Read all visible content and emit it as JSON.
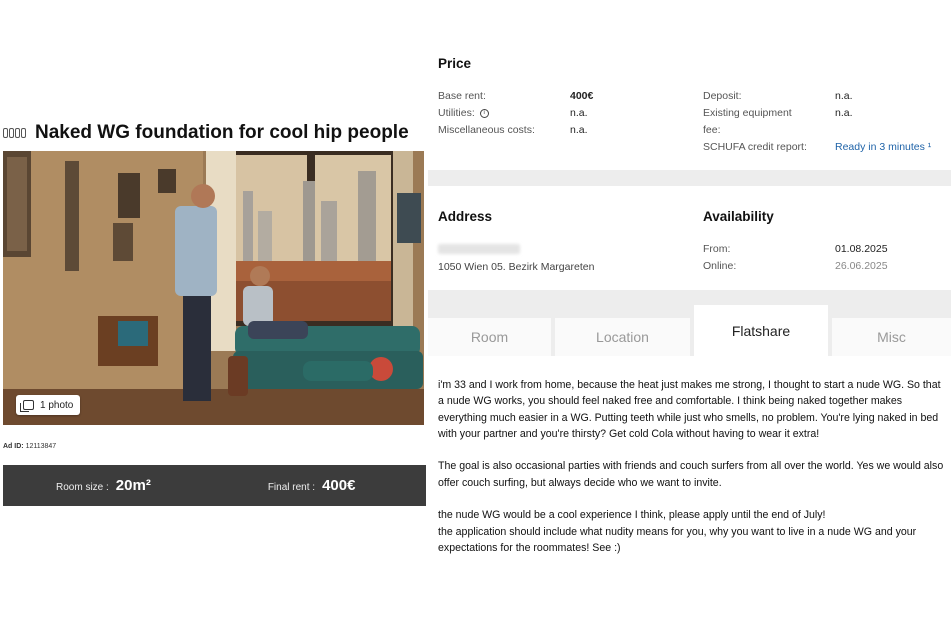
{
  "listing": {
    "title": "Naked WG foundation for cool hip people",
    "photo_label": "1 photo",
    "ad_id_label": "Ad ID:",
    "ad_id": "12113847",
    "room_size_label": "Room size :",
    "room_size": "20m²",
    "final_rent_label": "Final rent :",
    "final_rent": "400€"
  },
  "price": {
    "title": "Price",
    "base_rent_label": "Base rent:",
    "base_rent": "400€",
    "utilities_label": "Utilities:",
    "utilities": "n.a.",
    "misc_label": "Miscellaneous costs:",
    "misc": "n.a.",
    "deposit_label": "Deposit:",
    "deposit": "n.a.",
    "equipment_label_1": "Existing equipment",
    "equipment_label_2": "fee:",
    "equipment": "n.a.",
    "schufa_label": "SCHUFA credit report:",
    "schufa": "Ready in 3 minutes ¹"
  },
  "address": {
    "title": "Address",
    "line2": "1050 Wien 05. Bezirk Margareten"
  },
  "availability": {
    "title": "Availability",
    "from_label": "From:",
    "from": "01.08.2025",
    "online_label": "Online:",
    "online": "26.06.2025"
  },
  "tabs": [
    {
      "label": "Room"
    },
    {
      "label": "Location"
    },
    {
      "label": "Flatshare"
    },
    {
      "label": "Misc"
    }
  ],
  "description": {
    "p1": "i'm 33 and I work from home, because the heat just makes me strong, I thought to start a nude WG. So that a nude WG works, you should feel naked free and comfortable. I think being naked together makes everything much easier in a WG. Putting teeth while just who smells, no problem. You're lying naked in bed with your partner and you're thirsty? Get cold Cola without having to wear it extra!",
    "p2": "The goal is also occasional parties with friends and couch surfers from all over the world. Yes we would also offer couch surfing, but always decide who we want to invite.",
    "p3": "the nude WG would be a cool experience I think, please apply until the end of July!",
    "p4": "the application should include what nudity means for you, why you want to live in a nude WG and your expectations for the roommates! See :)"
  },
  "colors": {
    "summary_bar": "#3c3c3c",
    "link_blue": "#1f63a8",
    "band_gray": "#ededed"
  }
}
